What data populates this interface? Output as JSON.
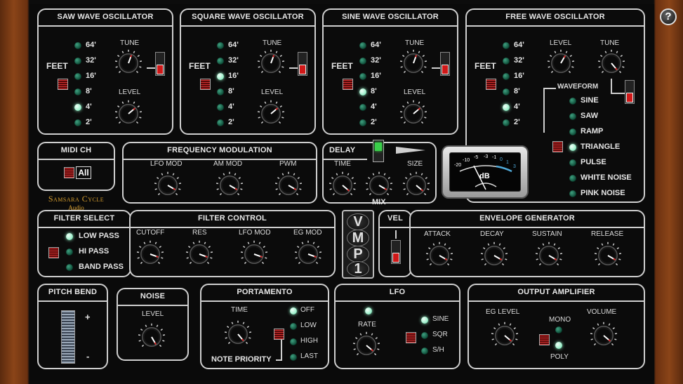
{
  "help": "?",
  "feet_label": "FEET",
  "feet_values": [
    "64'",
    "32'",
    "16'",
    "8'",
    "4'",
    "2'"
  ],
  "tune_label": "TUNE",
  "level_label": "LEVEL",
  "osc": [
    {
      "title": "SAW WAVE OSCILLATOR",
      "active_feet": 4
    },
    {
      "title": "SQUARE WAVE OSCILLATOR",
      "active_feet": 2
    },
    {
      "title": "SINE WAVE OSCILLATOR",
      "active_feet": 3
    },
    {
      "title": "FREE WAVE OSCILLATOR",
      "active_feet": 4
    }
  ],
  "free": {
    "waveform_label": "WAVEFORM",
    "waveforms": [
      "SINE",
      "SAW",
      "RAMP",
      "TRIANGLE",
      "PULSE",
      "WHITE NOISE",
      "PINK NOISE"
    ],
    "active_waveform": 3
  },
  "midi": {
    "title": "MIDI CH",
    "value": "All"
  },
  "brand": {
    "name": "Samsara Cycle",
    "sub": "Audio"
  },
  "fm": {
    "title": "FREQUENCY MODULATION",
    "knobs": [
      "LFO MOD",
      "AM MOD",
      "PWM"
    ]
  },
  "delay": {
    "title": "DELAY",
    "time": "TIME",
    "size": "SIZE",
    "mix": "MIX"
  },
  "meter": {
    "unit": "dB",
    "scale": [
      "-20",
      "-10",
      "-5",
      "-3",
      "-1",
      "0",
      "1",
      "3"
    ]
  },
  "filter_select": {
    "title": "FILTER SELECT",
    "options": [
      "LOW PASS",
      "HI PASS",
      "BAND PASS"
    ],
    "active": 0
  },
  "filter_control": {
    "title": "FILTER CONTROL",
    "knobs": [
      "CUTOFF",
      "RES",
      "LFO MOD",
      "EG MOD"
    ]
  },
  "logo": [
    "V",
    "M",
    "P",
    "1"
  ],
  "vel": {
    "title": "VEL"
  },
  "envelope": {
    "title": "ENVELOPE GENERATOR",
    "knobs": [
      "ATTACK",
      "DECAY",
      "SUSTAIN",
      "RELEASE"
    ]
  },
  "pitch_bend": {
    "title": "PITCH BEND",
    "plus": "+",
    "minus": "-"
  },
  "noise": {
    "title": "NOISE",
    "level": "LEVEL"
  },
  "portamento": {
    "title": "PORTAMENTO",
    "time": "TIME",
    "note_priority": "NOTE PRIORITY",
    "options": [
      "OFF",
      "LOW",
      "HIGH",
      "LAST"
    ],
    "active": 0
  },
  "lfo": {
    "title": "LFO",
    "rate": "RATE",
    "options": [
      "SINE",
      "SQR",
      "S/H"
    ],
    "active": 0
  },
  "output": {
    "title": "OUTPUT AMPLIFIER",
    "eg_level": "EG LEVEL",
    "mono": "MONO",
    "poly": "POLY",
    "volume": "VOLUME",
    "mode_active": "poly"
  },
  "accent": "#8fe8c0"
}
